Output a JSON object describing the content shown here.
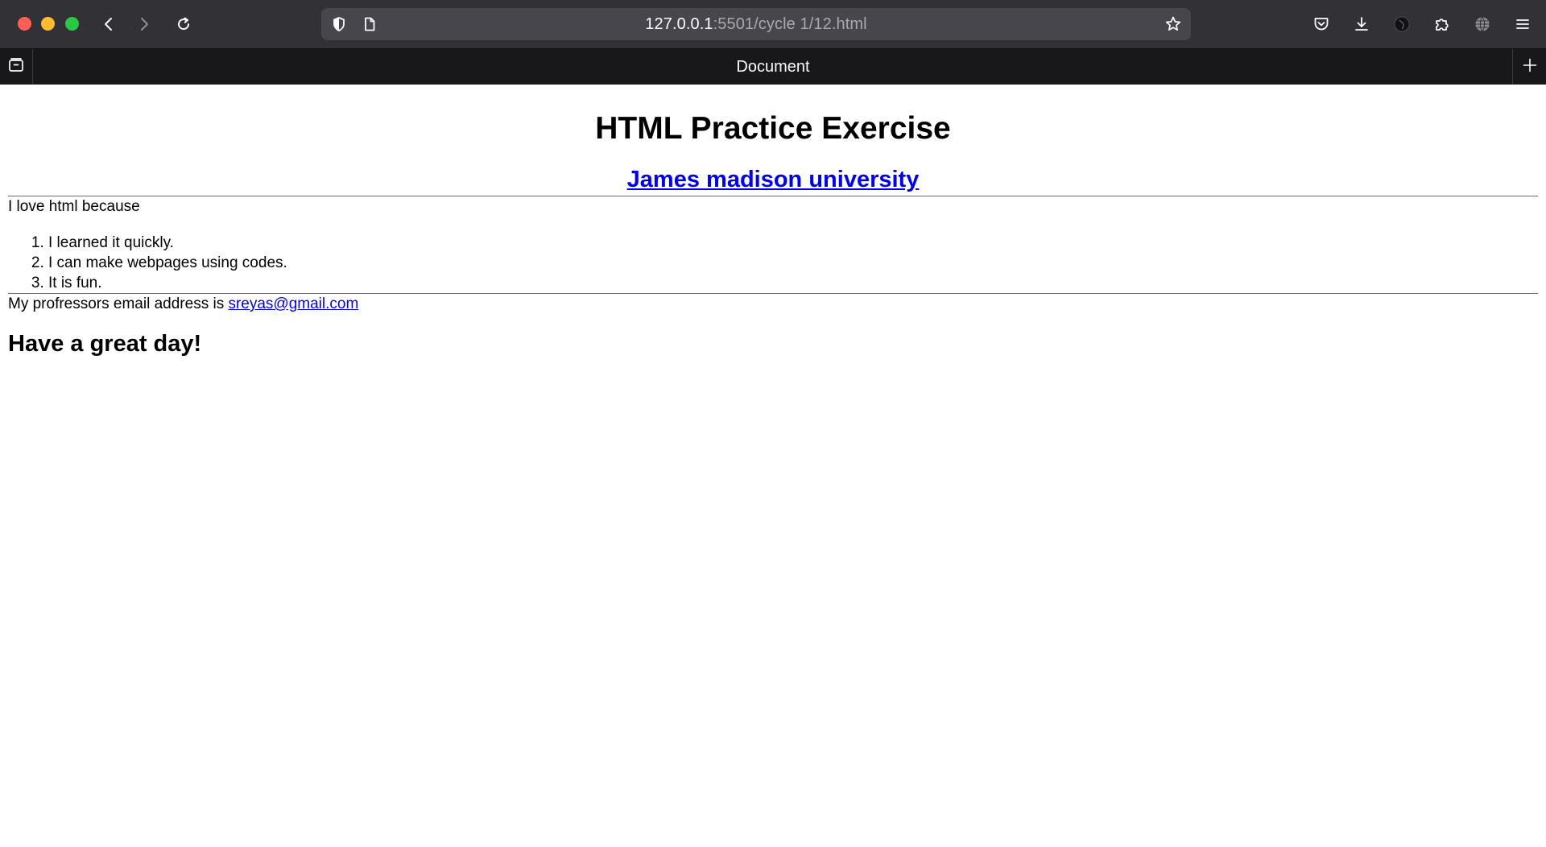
{
  "browser": {
    "url_host": "127.0.0.1",
    "url_path": ":5501/cycle 1/12.html",
    "tab_title": "Document",
    "icons": {
      "back": "back-arrow-icon",
      "forward": "forward-arrow-icon",
      "reload": "reload-icon",
      "tracking": "shield-icon",
      "page": "page-icon",
      "bookmark": "star-icon",
      "pocket": "pocket-icon",
      "downloads": "download-icon",
      "account": "account-icon",
      "extensions": "puzzle-icon",
      "globe": "globe-icon",
      "menu": "hamburger-menu-icon",
      "tab_list": "tab-list-icon",
      "new_tab": "plus-icon"
    },
    "colors": {
      "traffic_red": "#ff5f57",
      "traffic_yellow": "#febc2e",
      "traffic_green": "#28c840"
    }
  },
  "page": {
    "heading": "HTML Practice Exercise",
    "university_link": "James madison university",
    "intro": "I love html because",
    "reasons": [
      "I learned it quickly.",
      "I can make webpages using codes.",
      "It is fun."
    ],
    "email_prefix": "My profressors email address is ",
    "email_link": "sreyas@gmail.com",
    "closing": "Have a great day!",
    "link_color": "#0000ee"
  }
}
